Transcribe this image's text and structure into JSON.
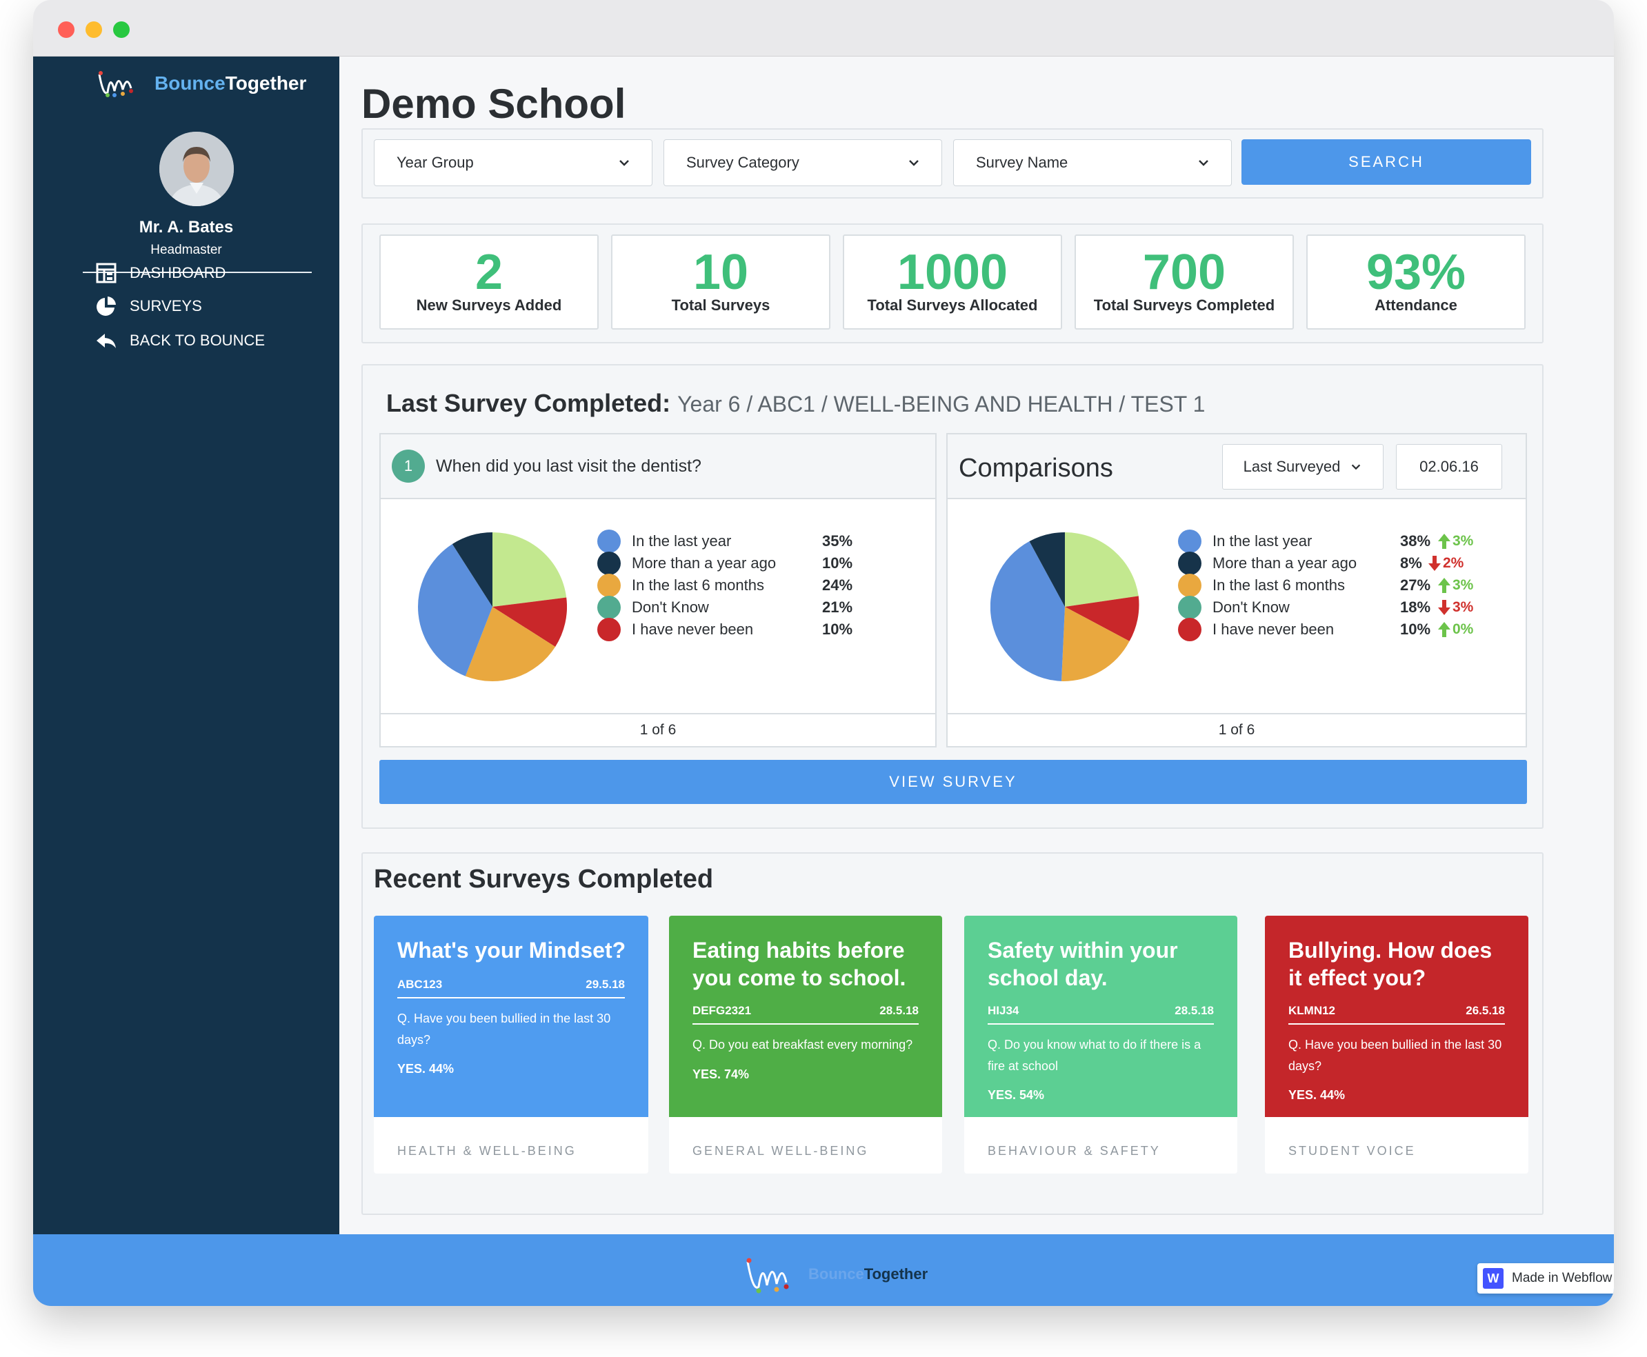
{
  "brand": {
    "name_part1": "Bounce",
    "name_part2": "Together"
  },
  "user": {
    "name": "Mr. A. Bates",
    "role": "Headmaster"
  },
  "nav": [
    {
      "label": "DASHBOARD",
      "icon": "dashboard-icon"
    },
    {
      "label": "SURVEYS",
      "icon": "pie-chart-icon"
    },
    {
      "label": "BACK TO BOUNCE",
      "icon": "reply-arrow-icon"
    }
  ],
  "page": {
    "title": "Demo School"
  },
  "filters": {
    "year_group": "Year Group",
    "survey_category": "Survey Category",
    "survey_name": "Survey Name",
    "search_label": "SEARCH"
  },
  "stats": [
    {
      "value": "2",
      "label": "New Surveys Added"
    },
    {
      "value": "10",
      "label": "Total Surveys"
    },
    {
      "value": "1000",
      "label": "Total Surveys Allocated"
    },
    {
      "value": "700",
      "label": "Total Surveys Completed"
    },
    {
      "value": "93%",
      "label": "Attendance"
    }
  ],
  "last_survey": {
    "heading": "Last Survey Completed:",
    "path": "Year 6 / ABC1 / WELL-BEING AND HEALTH / TEST 1",
    "question_number": "1",
    "question": "When did you last visit the dentist?",
    "pager": "1 of 6",
    "answers": [
      {
        "label": "In the last year",
        "pct": "35%",
        "color": "#5b8fdc"
      },
      {
        "label": "More than a year ago",
        "pct": "10%",
        "color": "#16334a"
      },
      {
        "label": "In the last 6 months",
        "pct": "24%",
        "color": "#e9a83f"
      },
      {
        "label": "Don't Know",
        "pct": "21%",
        "color": "#52ab90"
      },
      {
        "label": "I have never been",
        "pct": "10%",
        "color": "#c9272a"
      }
    ],
    "pie_colors": {
      "light_green": "#c3e88f"
    }
  },
  "comparisons": {
    "title": "Comparisons",
    "mode": "Last Surveyed",
    "date": "02.06.16",
    "pager": "1 of 6",
    "answers": [
      {
        "label": "In the last year",
        "pct": "38%",
        "delta": "3%",
        "direction": "up",
        "color": "#5b8fdc"
      },
      {
        "label": "More than a year ago",
        "pct": "8%",
        "delta": "2%",
        "direction": "down",
        "color": "#16334a"
      },
      {
        "label": "In the last 6 months",
        "pct": "27%",
        "delta": "3%",
        "direction": "up",
        "color": "#e9a83f"
      },
      {
        "label": "Don't Know",
        "pct": "18%",
        "delta": "3%",
        "direction": "down",
        "color": "#52ab90"
      },
      {
        "label": "I have never been",
        "pct": "10%",
        "delta": "0%",
        "direction": "up",
        "color": "#c9272a"
      }
    ]
  },
  "view_survey_label": "VIEW SURVEY",
  "recent": {
    "title": "Recent Surveys Completed",
    "cards": [
      {
        "title": "What's your Mindset?",
        "code": "ABC123",
        "date": "29.5.18",
        "question": "Q. Have you been bullied in the last 30 days?",
        "result": "YES. 44%",
        "category": "HEALTH & WELL-BEING",
        "color": "#4f9cf0"
      },
      {
        "title": "Eating habits before you come to school.",
        "code": "DEFG2321",
        "date": "28.5.18",
        "question": "Q. Do you eat breakfast every morning?",
        "result": "YES. 74%",
        "category": "GENERAL WELL-BEING",
        "color": "#4fae46"
      },
      {
        "title": "Safety within your school day.",
        "code": "HIJ34",
        "date": "28.5.18",
        "question": "Q. Do you know what to do if there is a fire at school",
        "result": "YES. 54%",
        "category": "BEHAVIOUR & SAFETY",
        "color": "#5ccf93"
      },
      {
        "title": "Bullying. How does it effect you?",
        "code": "KLMN12",
        "date": "26.5.18",
        "question": "Q. Have you been bullied in the last 30 days?",
        "result": "YES. 44%",
        "category": "STUDENT VOICE",
        "color": "#c4262a"
      }
    ]
  },
  "footer": {
    "badge": "Made in Webflow",
    "badge_icon": "W"
  }
}
